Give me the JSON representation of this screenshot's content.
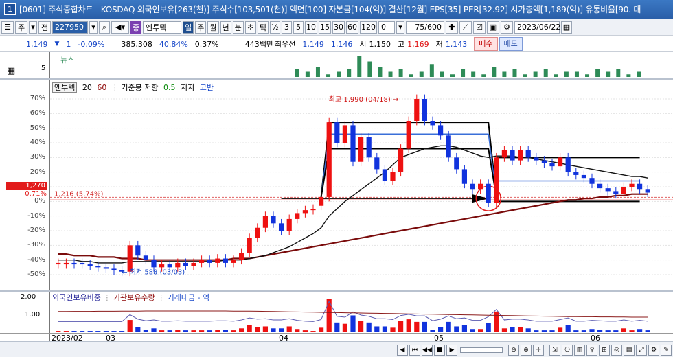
{
  "window": {
    "number": "1",
    "title": "[0601] 주식종합차트 - KOSDAQ 외국인보유[263(천)] 주식수[103,501(천)] 액면[100] 자본금[104(억)] 결산[12월] EPS[35] PER[32.92] 시가총액[1,189(억)] 유통비율[90. 대"
  },
  "toolbar": {
    "stock_type": "주",
    "range_btn": "전",
    "code_value": "227950",
    "jong_label": "종",
    "stock_name": "엔투텍",
    "periods": [
      "일",
      "주",
      "월",
      "년",
      "분",
      "초",
      "틱"
    ],
    "half": "½",
    "intervals": [
      "3",
      "5",
      "10",
      "15",
      "30",
      "60",
      "120"
    ],
    "count_value": "0",
    "view_count": "75/600",
    "date_value": "2023/06/22"
  },
  "quote": {
    "price": "1,149",
    "change_arrow": "▼",
    "change": "1",
    "change_pct": "-0.09%",
    "volume": "385,308",
    "pct1": "40.84%",
    "pct2": "0.37%",
    "amount": "443백만",
    "best_label": "최우선",
    "best_bid": "1,149",
    "best_ask": "1,146",
    "open_label": "시",
    "open": "1,150",
    "high_label": "고",
    "high": "1,169",
    "low_label": "저",
    "low": "1,143",
    "buy_label": "매수",
    "sell_label": "매도"
  },
  "news_panel": {
    "label": "뉴스",
    "tick_5": "5",
    "bars": [
      3,
      2,
      4,
      1,
      2,
      3,
      8,
      6,
      4,
      2,
      3,
      1,
      2,
      5,
      2,
      1,
      3,
      2,
      1,
      4,
      2,
      3,
      1,
      2,
      3,
      1,
      2,
      2,
      1,
      3,
      2,
      3,
      1,
      2
    ],
    "bar_color": "#2e8b57"
  },
  "main_chart": {
    "legend_name": "엔투텍",
    "ma1": "20",
    "ma2": "60",
    "base_label": "기준봉 저항",
    "base_value": "0.5",
    "support_label": "지지",
    "break_label": "고반",
    "y_ticks": [
      "70%",
      "60%",
      "50%",
      "40%",
      "30%",
      "20%",
      "10%",
      "0%",
      "-10%",
      "-20%",
      "-30%",
      "-40%",
      "-50%"
    ],
    "current_price_tag": "1,270",
    "current_pct_tag": "0.71%",
    "ref_line_label": "1,216 (5.74%)",
    "high_annotation": "최고 1,990 (04/18)",
    "low_annotation": "최저 588 (03/03)",
    "up_color": "#ee1111",
    "down_color": "#1133dd"
  },
  "sub_chart": {
    "legend1": "외국인보유비중",
    "legend2": "기관보유수량",
    "legend3": "거래대금 - 억",
    "y_ticks": [
      "2.00",
      "1.00"
    ],
    "date_labels": [
      "2023/02",
      "03",
      "04",
      "05",
      "06"
    ]
  },
  "chart_data": {
    "type": "candlestick",
    "unit": "% vs reference price",
    "candles": [
      {
        "o": -43,
        "c": -42
      },
      {
        "o": -43,
        "c": -42
      },
      {
        "o": -42,
        "c": -43
      },
      {
        "o": -42,
        "c": -43
      },
      {
        "o": -43,
        "c": -44
      },
      {
        "o": -44,
        "c": -45
      },
      {
        "o": -45,
        "c": -46
      },
      {
        "o": -46,
        "c": -47
      },
      {
        "o": -47,
        "c": -48
      },
      {
        "o": -48,
        "c": -30
      },
      {
        "o": -30,
        "c": -37
      },
      {
        "o": -37,
        "c": -40
      },
      {
        "o": -40,
        "c": -45
      },
      {
        "o": -45,
        "c": -43
      },
      {
        "o": -43,
        "c": -45
      },
      {
        "o": -45,
        "c": -42
      },
      {
        "o": -42,
        "c": -44
      },
      {
        "o": -44,
        "c": -42
      },
      {
        "o": -42,
        "c": -40
      },
      {
        "o": -40,
        "c": -42
      },
      {
        "o": -42,
        "c": -39
      },
      {
        "o": -39,
        "c": -42
      },
      {
        "o": -42,
        "c": -40
      },
      {
        "o": -40,
        "c": -35
      },
      {
        "o": -35,
        "c": -25
      },
      {
        "o": -25,
        "c": -18
      },
      {
        "o": -18,
        "c": -10
      },
      {
        "o": -10,
        "c": -15
      },
      {
        "o": -15,
        "c": -20
      },
      {
        "o": -20,
        "c": -12
      },
      {
        "o": -12,
        "c": -8
      },
      {
        "o": -8,
        "c": -6
      },
      {
        "o": -6,
        "c": -5
      },
      {
        "o": -3,
        "c": 3
      },
      {
        "o": 3,
        "c": 54
      },
      {
        "o": 54,
        "c": 40
      },
      {
        "o": 40,
        "c": 52
      },
      {
        "o": 52,
        "c": 27
      },
      {
        "o": 27,
        "c": 44
      },
      {
        "o": 44,
        "c": 30
      },
      {
        "o": 30,
        "c": 22
      },
      {
        "o": 22,
        "c": 14
      },
      {
        "o": 14,
        "c": 20
      },
      {
        "o": 20,
        "c": 36
      },
      {
        "o": 36,
        "c": 55
      },
      {
        "o": 55,
        "c": 70
      },
      {
        "o": 70,
        "c": 55
      },
      {
        "o": 55,
        "c": 52
      },
      {
        "o": 52,
        "c": 45
      },
      {
        "o": 45,
        "c": 30
      },
      {
        "o": 30,
        "c": 22
      },
      {
        "o": 22,
        "c": 12
      },
      {
        "o": 12,
        "c": 8
      },
      {
        "o": 8,
        "c": 12
      },
      {
        "o": 12,
        "c": -1
      },
      {
        "o": -1,
        "c": 30
      },
      {
        "o": 30,
        "c": 35
      },
      {
        "o": 35,
        "c": 28
      },
      {
        "o": 28,
        "c": 35
      },
      {
        "o": 35,
        "c": 30
      },
      {
        "o": 30,
        "c": 28
      },
      {
        "o": 28,
        "c": 26
      },
      {
        "o": 26,
        "c": 24
      },
      {
        "o": 24,
        "c": 30
      },
      {
        "o": 30,
        "c": 20
      },
      {
        "o": 20,
        "c": 18
      },
      {
        "o": 18,
        "c": 16
      },
      {
        "o": 16,
        "c": 12
      },
      {
        "o": 12,
        "c": 9
      },
      {
        "o": 9,
        "c": 7
      },
      {
        "o": 7,
        "c": 5
      },
      {
        "o": 5,
        "c": 10
      },
      {
        "o": 10,
        "c": 12
      },
      {
        "o": 12,
        "c": 8
      },
      {
        "o": 8,
        "c": 6
      }
    ],
    "ma20": [
      -40,
      -40,
      -40,
      -41,
      -41,
      -42,
      -42,
      -42,
      -42,
      -41,
      -41,
      -41,
      -41,
      -41,
      -41,
      -41,
      -41,
      -41,
      -41,
      -41,
      -41,
      -40,
      -40,
      -40,
      -39,
      -38,
      -37,
      -35,
      -33,
      -31,
      -28,
      -25,
      -22,
      -18,
      -10,
      -5,
      0,
      4,
      8,
      12,
      16,
      20,
      25,
      30,
      32,
      34,
      36,
      37,
      38,
      38,
      37,
      35,
      33,
      31,
      30,
      31,
      31,
      31,
      30,
      30,
      29,
      28,
      27,
      26,
      25,
      24,
      23,
      22,
      21,
      20,
      19,
      18,
      17,
      17,
      16
    ],
    "ma60": [
      -36,
      -36,
      -37,
      -37,
      -37,
      -38,
      -38,
      -38,
      -39,
      -39,
      -39,
      -40,
      -40,
      -40,
      -40,
      -40,
      -40,
      -40,
      -40,
      -40,
      -40,
      -40,
      -39,
      -39,
      -39,
      -38,
      -37,
      -36,
      -35,
      -34,
      -33,
      -32,
      -31,
      -30,
      -29,
      -28,
      -27,
      -26,
      -25,
      -24,
      -23,
      -22,
      -21,
      -20,
      -19,
      -18,
      -17,
      -16,
      -15,
      -14,
      -13,
      -12,
      -11,
      -10,
      -9,
      -8,
      -7,
      -6,
      -5,
      -4,
      -3,
      -2,
      -1,
      0,
      1,
      1,
      2,
      2,
      3,
      3,
      4,
      4,
      5,
      5,
      5
    ]
  }
}
